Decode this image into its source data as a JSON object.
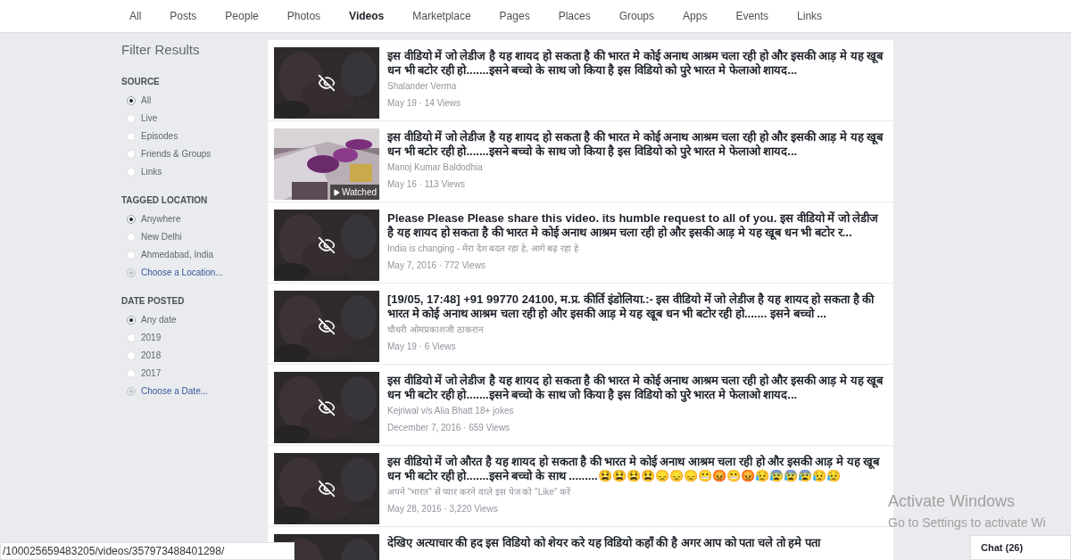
{
  "tabs": [
    {
      "label": "All",
      "selected": false
    },
    {
      "label": "Posts",
      "selected": false
    },
    {
      "label": "People",
      "selected": false
    },
    {
      "label": "Photos",
      "selected": false
    },
    {
      "label": "Videos",
      "selected": true
    },
    {
      "label": "Marketplace",
      "selected": false
    },
    {
      "label": "Pages",
      "selected": false
    },
    {
      "label": "Places",
      "selected": false
    },
    {
      "label": "Groups",
      "selected": false
    },
    {
      "label": "Apps",
      "selected": false
    },
    {
      "label": "Events",
      "selected": false
    },
    {
      "label": "Links",
      "selected": false
    }
  ],
  "filter": {
    "title": "Filter Results",
    "sections": [
      {
        "heading": "SOURCE",
        "options": [
          {
            "label": "All",
            "selected": true
          },
          {
            "label": "Live",
            "selected": false
          },
          {
            "label": "Episodes",
            "selected": false
          },
          {
            "label": "Friends & Groups",
            "selected": false
          },
          {
            "label": "Links",
            "selected": false
          }
        ]
      },
      {
        "heading": "TAGGED LOCATION",
        "options": [
          {
            "label": "Anywhere",
            "selected": true
          },
          {
            "label": "New Delhi",
            "selected": false
          },
          {
            "label": "Ahmedabad, India",
            "selected": false
          }
        ],
        "link": "Choose a Location..."
      },
      {
        "heading": "DATE POSTED",
        "options": [
          {
            "label": "Any date",
            "selected": true
          },
          {
            "label": "2019",
            "selected": false
          },
          {
            "label": "2018",
            "selected": false
          },
          {
            "label": "2017",
            "selected": false
          }
        ],
        "link": "Choose a Date..."
      }
    ]
  },
  "results": [
    {
      "hidden": true,
      "title": "इस वीडियो में जो लेडीज है यह शायद हो सकता है की भारत मे कोई अनाथ आश्रम चला रही हो और इसकी आड़ मे यह खूब धन भी बटोर रही हो.......इसने बच्चो के साथ जो किया है इस विडियो को पुरे भारत मे फेलाओ शायद...",
      "source": "Shalander Verma",
      "meta": "May 19 · 14 Views"
    },
    {
      "hidden": false,
      "watched": true,
      "watched_label": "Watched",
      "title": "इस वीडियो में जो लेडीज है यह शायद हो सकता है की भारत मे कोई अनाथ आश्रम चला रही हो और इसकी आड़ मे यह खूब धन भी बटोर रही हो.......इसने बच्चो के साथ जो किया है इस विडियो को पुरे भारत मे फेलाओ शायद...",
      "source": "Manoj Kumar Baldodhia",
      "meta": "May 16 · 113 Views"
    },
    {
      "hidden": true,
      "title": "Please Please Please share this video. its humble request to all of you. इस वीडियो में जो लेडीज है यह शायद हो सकता है की भारत मे कोई अनाथ आश्रम चला रही हो और इसकी आड़ मे यह खूब धन भी बटोर र...",
      "source": "India is changing - मेरा देश बदल रहा हे, आगे बढ़ रहा हे",
      "meta": "May 7, 2016 · 772 Views"
    },
    {
      "hidden": true,
      "title": "[19/05, 17:48] +91 99770 24100, म.प्र. कीर्ति इंडोलिया.:- इस वीडियो में जो लेडीज है यह शायद हो सकता है की भारत मे कोई अनाथ आश्रम चला रही हो और इसकी आड़ मे यह खूब धन भी बटोर रही हो....... इसने बच्चो ...",
      "source": "चौधरी ओमप्रकाशजी ठाकरान",
      "meta": "May 19 · 6 Views"
    },
    {
      "hidden": true,
      "title": "इस वीडियो में जो लेडीज है यह शायद हो सकता है की भारत मे कोई अनाथ आश्रम चला रही हो और इसकी आड़ मे यह खूब धन भी बटोर रही हो.......इसने बच्चो के साथ जो किया है इस विडियो को पुरे भारत मे फेलाओ शायद...",
      "source": "Kejriwal v/s Alia Bhatt 18+ jokes",
      "meta": "December 7, 2016 · 659 Views"
    },
    {
      "hidden": true,
      "title": "इस वीडियो में जो औरत है यह शायद हो सकता है की भारत मे कोई अनाथ आश्रम चला रही हो और इसकी आड़ मे यह खूब धन भी बटोर रही हो.......इसने बच्चो के साथ .........😫😫😫😫😞😞😞😬😡😬😡😥😰😰😰😥😥",
      "source": "अपने \"भारत\" से प्यार करने वाले इस पेज को \"Like\" करें",
      "meta": "May 28, 2016 · 3,220 Views"
    },
    {
      "title": "देखिए अत्याचार की हद इस विडियो को शेयर करे यह विडियो कहाँ की है अगर आप को पता चले तो हमे पता"
    }
  ],
  "status_url": "/100025659483205/videos/357973488401298/",
  "watermark": [
    "Activate Windows",
    "Go to Settings to activate Wi"
  ],
  "chat": {
    "label": "Chat (26)"
  }
}
